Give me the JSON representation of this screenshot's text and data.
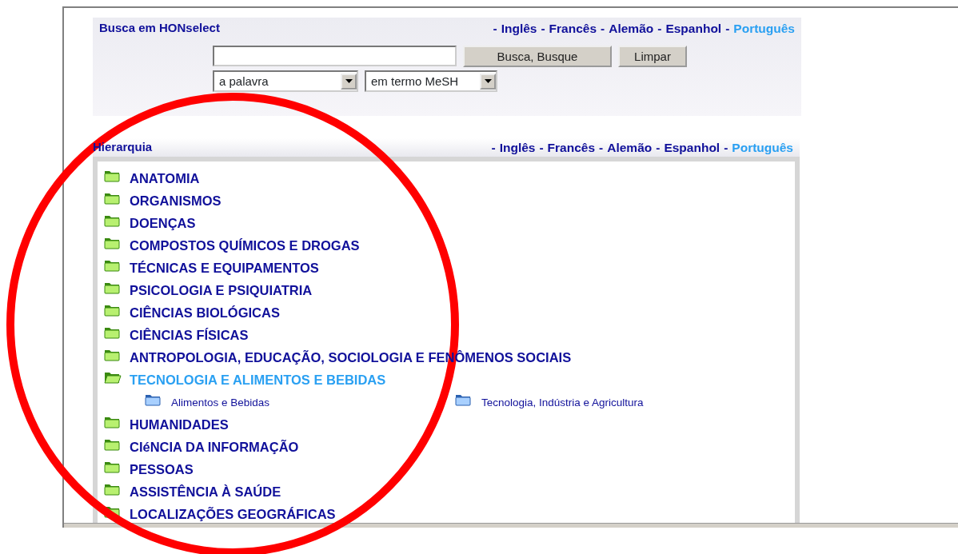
{
  "search_panel": {
    "title": "Busca em HONselect",
    "separator": "-",
    "languages": [
      {
        "label": "Inglês",
        "selected": false
      },
      {
        "label": "Francês",
        "selected": false
      },
      {
        "label": "Alemão",
        "selected": false
      },
      {
        "label": "Espanhol",
        "selected": false
      },
      {
        "label": "Português",
        "selected": true
      }
    ],
    "search_button": "Busca, Busque",
    "clear_button": "Limpar",
    "match_select": "a palavra",
    "scope_select": "em termo MeSH"
  },
  "hierarchy": {
    "title": "Hierarquia",
    "separator": "-",
    "languages": [
      {
        "label": "Inglês",
        "selected": false
      },
      {
        "label": "Francês",
        "selected": false
      },
      {
        "label": "Alemão",
        "selected": false
      },
      {
        "label": "Espanhol",
        "selected": false
      },
      {
        "label": "Português",
        "selected": true
      }
    ],
    "categories": [
      {
        "label": "ANATOMIA",
        "expanded": false
      },
      {
        "label": "ORGANISMOS",
        "expanded": false
      },
      {
        "label": "DOENÇAS",
        "expanded": false
      },
      {
        "label": "COMPOSTOS QUÍMICOS E DROGAS",
        "expanded": false
      },
      {
        "label": "TÉCNICAS E EQUIPAMENTOS",
        "expanded": false
      },
      {
        "label": "PSICOLOGIA E PSIQUIATRIA",
        "expanded": false
      },
      {
        "label": "CIÊNCIAS BIOLÓGICAS",
        "expanded": false
      },
      {
        "label": "CIÊNCIAS FÍSICAS",
        "expanded": false
      },
      {
        "label": "ANTROPOLOGIA, EDUCAÇÃO, SOCIOLOGIA E FENÔMENOS SOCIAIS",
        "expanded": false
      },
      {
        "label": "TECNOLOGIA E ALIMENTOS E BEBIDAS",
        "expanded": true,
        "children": [
          {
            "label": "Alimentos e Bebidas"
          },
          {
            "label": "Tecnologia, Indústria e Agricultura"
          }
        ]
      },
      {
        "label": "HUMANIDADES",
        "expanded": false
      },
      {
        "label": "CIéNCIA DA INFORMAÇÃO",
        "expanded": false
      },
      {
        "label": "PESSOAS",
        "expanded": false
      },
      {
        "label": "ASSISTÊNCIA À SAÚDE",
        "expanded": false
      },
      {
        "label": "LOCALIZAÇÕES GEOGRÁFICAS",
        "expanded": false
      }
    ]
  }
}
